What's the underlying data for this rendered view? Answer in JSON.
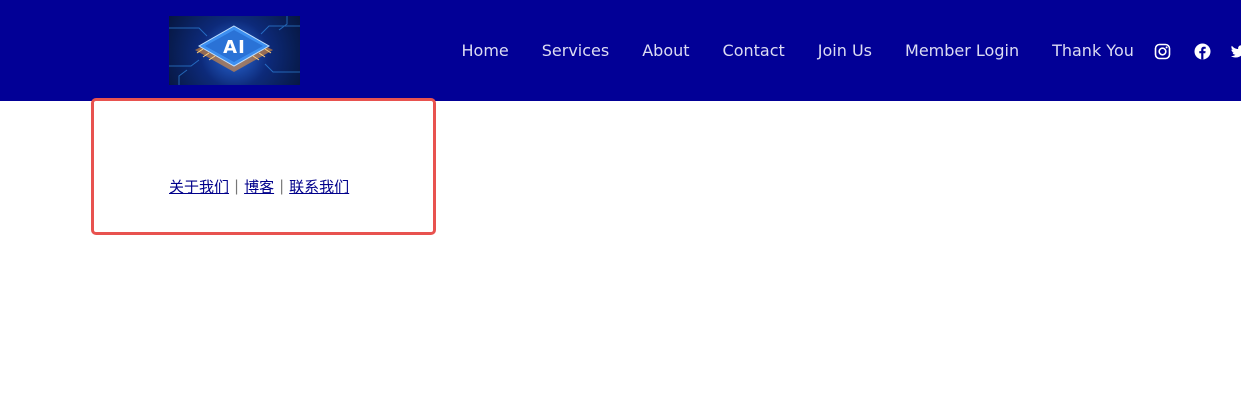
{
  "header": {
    "logo": {
      "label": "AI",
      "icon": "ai-chip-logo"
    },
    "nav": [
      {
        "label": "Home"
      },
      {
        "label": "Services"
      },
      {
        "label": "About"
      },
      {
        "label": "Contact"
      },
      {
        "label": "Join Us"
      },
      {
        "label": "Member Login"
      },
      {
        "label": "Thank You"
      }
    ],
    "social": [
      {
        "icon": "instagram-icon"
      },
      {
        "icon": "facebook-icon"
      },
      {
        "icon": "twitter-icon"
      }
    ],
    "colors": {
      "background": "#020096",
      "nav_text": "#dcdcf2"
    }
  },
  "footer_links": {
    "items": [
      {
        "label": "关于我们"
      },
      {
        "label": "博客"
      },
      {
        "label": "联系我们"
      }
    ],
    "separator": "|",
    "colors": {
      "link": "#00008b",
      "highlight_border": "#e8524f"
    }
  }
}
